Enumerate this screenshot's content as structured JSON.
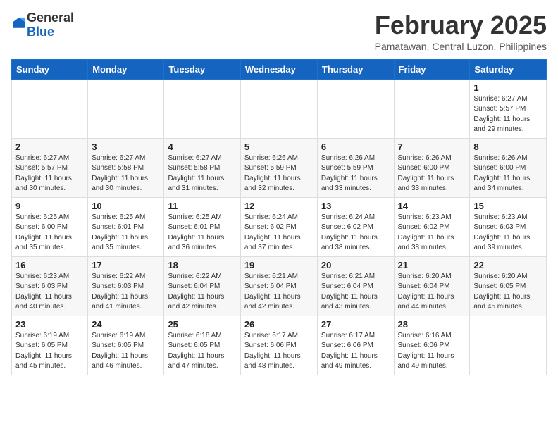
{
  "header": {
    "logo_general": "General",
    "logo_blue": "Blue",
    "month_year": "February 2025",
    "location": "Pamatawan, Central Luzon, Philippines"
  },
  "days_of_week": [
    "Sunday",
    "Monday",
    "Tuesday",
    "Wednesday",
    "Thursday",
    "Friday",
    "Saturday"
  ],
  "weeks": [
    [
      {
        "day": "",
        "info": ""
      },
      {
        "day": "",
        "info": ""
      },
      {
        "day": "",
        "info": ""
      },
      {
        "day": "",
        "info": ""
      },
      {
        "day": "",
        "info": ""
      },
      {
        "day": "",
        "info": ""
      },
      {
        "day": "1",
        "info": "Sunrise: 6:27 AM\nSunset: 5:57 PM\nDaylight: 11 hours\nand 29 minutes."
      }
    ],
    [
      {
        "day": "2",
        "info": "Sunrise: 6:27 AM\nSunset: 5:57 PM\nDaylight: 11 hours\nand 30 minutes."
      },
      {
        "day": "3",
        "info": "Sunrise: 6:27 AM\nSunset: 5:58 PM\nDaylight: 11 hours\nand 30 minutes."
      },
      {
        "day": "4",
        "info": "Sunrise: 6:27 AM\nSunset: 5:58 PM\nDaylight: 11 hours\nand 31 minutes."
      },
      {
        "day": "5",
        "info": "Sunrise: 6:26 AM\nSunset: 5:59 PM\nDaylight: 11 hours\nand 32 minutes."
      },
      {
        "day": "6",
        "info": "Sunrise: 6:26 AM\nSunset: 5:59 PM\nDaylight: 11 hours\nand 33 minutes."
      },
      {
        "day": "7",
        "info": "Sunrise: 6:26 AM\nSunset: 6:00 PM\nDaylight: 11 hours\nand 33 minutes."
      },
      {
        "day": "8",
        "info": "Sunrise: 6:26 AM\nSunset: 6:00 PM\nDaylight: 11 hours\nand 34 minutes."
      }
    ],
    [
      {
        "day": "9",
        "info": "Sunrise: 6:25 AM\nSunset: 6:00 PM\nDaylight: 11 hours\nand 35 minutes."
      },
      {
        "day": "10",
        "info": "Sunrise: 6:25 AM\nSunset: 6:01 PM\nDaylight: 11 hours\nand 35 minutes."
      },
      {
        "day": "11",
        "info": "Sunrise: 6:25 AM\nSunset: 6:01 PM\nDaylight: 11 hours\nand 36 minutes."
      },
      {
        "day": "12",
        "info": "Sunrise: 6:24 AM\nSunset: 6:02 PM\nDaylight: 11 hours\nand 37 minutes."
      },
      {
        "day": "13",
        "info": "Sunrise: 6:24 AM\nSunset: 6:02 PM\nDaylight: 11 hours\nand 38 minutes."
      },
      {
        "day": "14",
        "info": "Sunrise: 6:23 AM\nSunset: 6:02 PM\nDaylight: 11 hours\nand 38 minutes."
      },
      {
        "day": "15",
        "info": "Sunrise: 6:23 AM\nSunset: 6:03 PM\nDaylight: 11 hours\nand 39 minutes."
      }
    ],
    [
      {
        "day": "16",
        "info": "Sunrise: 6:23 AM\nSunset: 6:03 PM\nDaylight: 11 hours\nand 40 minutes."
      },
      {
        "day": "17",
        "info": "Sunrise: 6:22 AM\nSunset: 6:03 PM\nDaylight: 11 hours\nand 41 minutes."
      },
      {
        "day": "18",
        "info": "Sunrise: 6:22 AM\nSunset: 6:04 PM\nDaylight: 11 hours\nand 42 minutes."
      },
      {
        "day": "19",
        "info": "Sunrise: 6:21 AM\nSunset: 6:04 PM\nDaylight: 11 hours\nand 42 minutes."
      },
      {
        "day": "20",
        "info": "Sunrise: 6:21 AM\nSunset: 6:04 PM\nDaylight: 11 hours\nand 43 minutes."
      },
      {
        "day": "21",
        "info": "Sunrise: 6:20 AM\nSunset: 6:04 PM\nDaylight: 11 hours\nand 44 minutes."
      },
      {
        "day": "22",
        "info": "Sunrise: 6:20 AM\nSunset: 6:05 PM\nDaylight: 11 hours\nand 45 minutes."
      }
    ],
    [
      {
        "day": "23",
        "info": "Sunrise: 6:19 AM\nSunset: 6:05 PM\nDaylight: 11 hours\nand 45 minutes."
      },
      {
        "day": "24",
        "info": "Sunrise: 6:19 AM\nSunset: 6:05 PM\nDaylight: 11 hours\nand 46 minutes."
      },
      {
        "day": "25",
        "info": "Sunrise: 6:18 AM\nSunset: 6:05 PM\nDaylight: 11 hours\nand 47 minutes."
      },
      {
        "day": "26",
        "info": "Sunrise: 6:17 AM\nSunset: 6:06 PM\nDaylight: 11 hours\nand 48 minutes."
      },
      {
        "day": "27",
        "info": "Sunrise: 6:17 AM\nSunset: 6:06 PM\nDaylight: 11 hours\nand 49 minutes."
      },
      {
        "day": "28",
        "info": "Sunrise: 6:16 AM\nSunset: 6:06 PM\nDaylight: 11 hours\nand 49 minutes."
      },
      {
        "day": "",
        "info": ""
      }
    ]
  ]
}
